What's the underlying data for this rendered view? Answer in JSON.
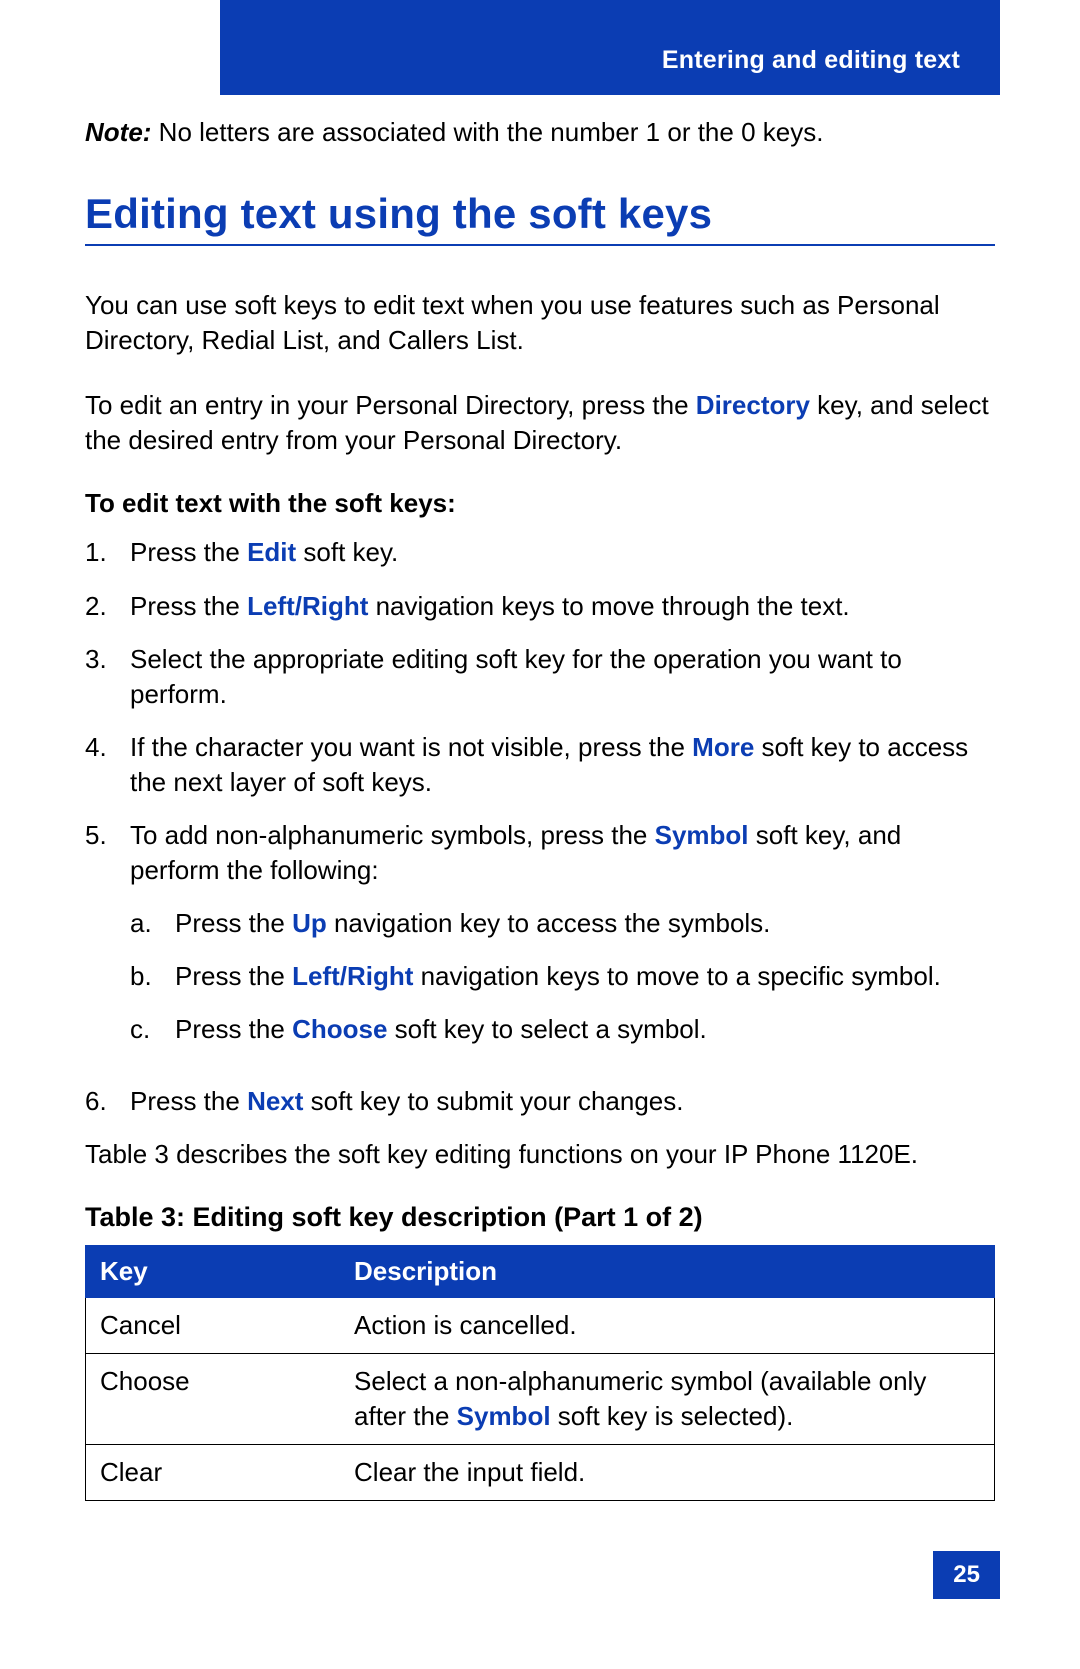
{
  "header": {
    "title": "Entering and editing text"
  },
  "note": {
    "label": "Note:",
    "text": " No letters are associated with the number 1 or the 0 keys."
  },
  "section_title": "Editing text using the soft keys",
  "intro1": "You can use soft keys to edit text when you use features such as Personal Directory, Redial List, and Callers List.",
  "intro2a": "To edit an entry in your Personal Directory, press the ",
  "intro2_kw": "Directory",
  "intro2b": " key, and select the desired entry from your Personal Directory.",
  "subhead": "To edit text with the soft keys:",
  "steps": {
    "s1": {
      "num": "1.",
      "a": "Press the ",
      "kw": "Edit",
      "b": " soft key."
    },
    "s2": {
      "num": "2.",
      "a": "Press the ",
      "kw": "Left/Right",
      "b": " navigation keys to move through the text."
    },
    "s3": {
      "num": "3.",
      "a": "Select the appropriate editing soft key for the operation you want to perform."
    },
    "s4": {
      "num": "4.",
      "a": "If the character you want is not visible, press the ",
      "kw": "More",
      "b": " soft key to access the next layer of soft keys."
    },
    "s5": {
      "num": "5.",
      "a": "To add non-alphanumeric symbols, press the ",
      "kw": "Symbol",
      "b": " soft key, and perform the following:"
    },
    "s5a": {
      "num": "a.",
      "a": "Press the ",
      "kw": "Up",
      "b": " navigation key to access the symbols."
    },
    "s5b": {
      "num": "b.",
      "a": "Press the ",
      "kw": "Left/Right",
      "b": " navigation keys to move to a specific symbol."
    },
    "s5c": {
      "num": "c.",
      "a": "Press the ",
      "kw": "Choose",
      "b": " soft key to select a symbol."
    },
    "s6": {
      "num": "6.",
      "a": "Press the ",
      "kw": "Next",
      "b": " soft key to submit your changes."
    }
  },
  "table_intro": "Table 3 describes the soft key editing functions on your IP Phone 1120E.",
  "table_caption": "Table 3: Editing soft key description (Part 1 of 2)",
  "table": {
    "head": {
      "c1": "Key",
      "c2": "Description"
    },
    "rows": {
      "r1": {
        "key": "Cancel",
        "desc": "Action is cancelled."
      },
      "r2": {
        "key": "Choose",
        "desc_a": "Select a non-alphanumeric symbol (available only after the ",
        "kw": "Symbol",
        "desc_b": " soft key is selected)."
      },
      "r3": {
        "key": "Clear",
        "desc": "Clear the input field."
      }
    }
  },
  "page_number": "25"
}
